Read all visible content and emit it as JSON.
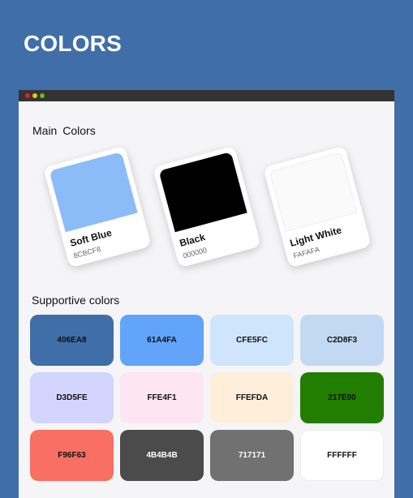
{
  "header": {
    "title": "COLORS"
  },
  "window": {
    "controls": [
      {
        "name": "close",
        "color": "#ee1c1c"
      },
      {
        "name": "minimize",
        "color": "#f4c20d"
      },
      {
        "name": "maximize",
        "color": "#52c41a"
      }
    ]
  },
  "main_colors": {
    "title": "Main  Colors",
    "items": [
      {
        "name": "Soft Blue",
        "hex": "8CBCF8",
        "color": "#8cbcf8"
      },
      {
        "name": "Black",
        "hex": "000000",
        "color": "#000000"
      },
      {
        "name": "Light White",
        "hex": "FAFAFA",
        "color": "#fafafa"
      }
    ]
  },
  "supportive_colors": {
    "title": "Supportive colors",
    "items": [
      {
        "hex": "406EA8",
        "color": "#406ea8",
        "text_color": "#111111"
      },
      {
        "hex": "61A4FA",
        "color": "#61a4fa",
        "text_color": "#111111"
      },
      {
        "hex": "CFE5FC",
        "color": "#cfe5fc",
        "text_color": "#111111"
      },
      {
        "hex": "C2D8F3",
        "color": "#c2d8f3",
        "text_color": "#111111"
      },
      {
        "hex": "D3D5FE",
        "color": "#d3d5fe",
        "text_color": "#111111"
      },
      {
        "hex": "FFE4F1",
        "color": "#ffe4f1",
        "text_color": "#111111"
      },
      {
        "hex": "FFEFDA",
        "color": "#ffefda",
        "text_color": "#111111"
      },
      {
        "hex": "217E00",
        "color": "#217e00",
        "text_color": "#111111"
      },
      {
        "hex": "F96F63",
        "color": "#f96f63",
        "text_color": "#111111"
      },
      {
        "hex": "4B4B4B",
        "color": "#4b4b4b",
        "text_color": "#ffffff"
      },
      {
        "hex": "717171",
        "color": "#717171",
        "text_color": "#ffffff"
      },
      {
        "hex": "FFFFFF",
        "color": "#ffffff",
        "text_color": "#111111"
      }
    ]
  }
}
